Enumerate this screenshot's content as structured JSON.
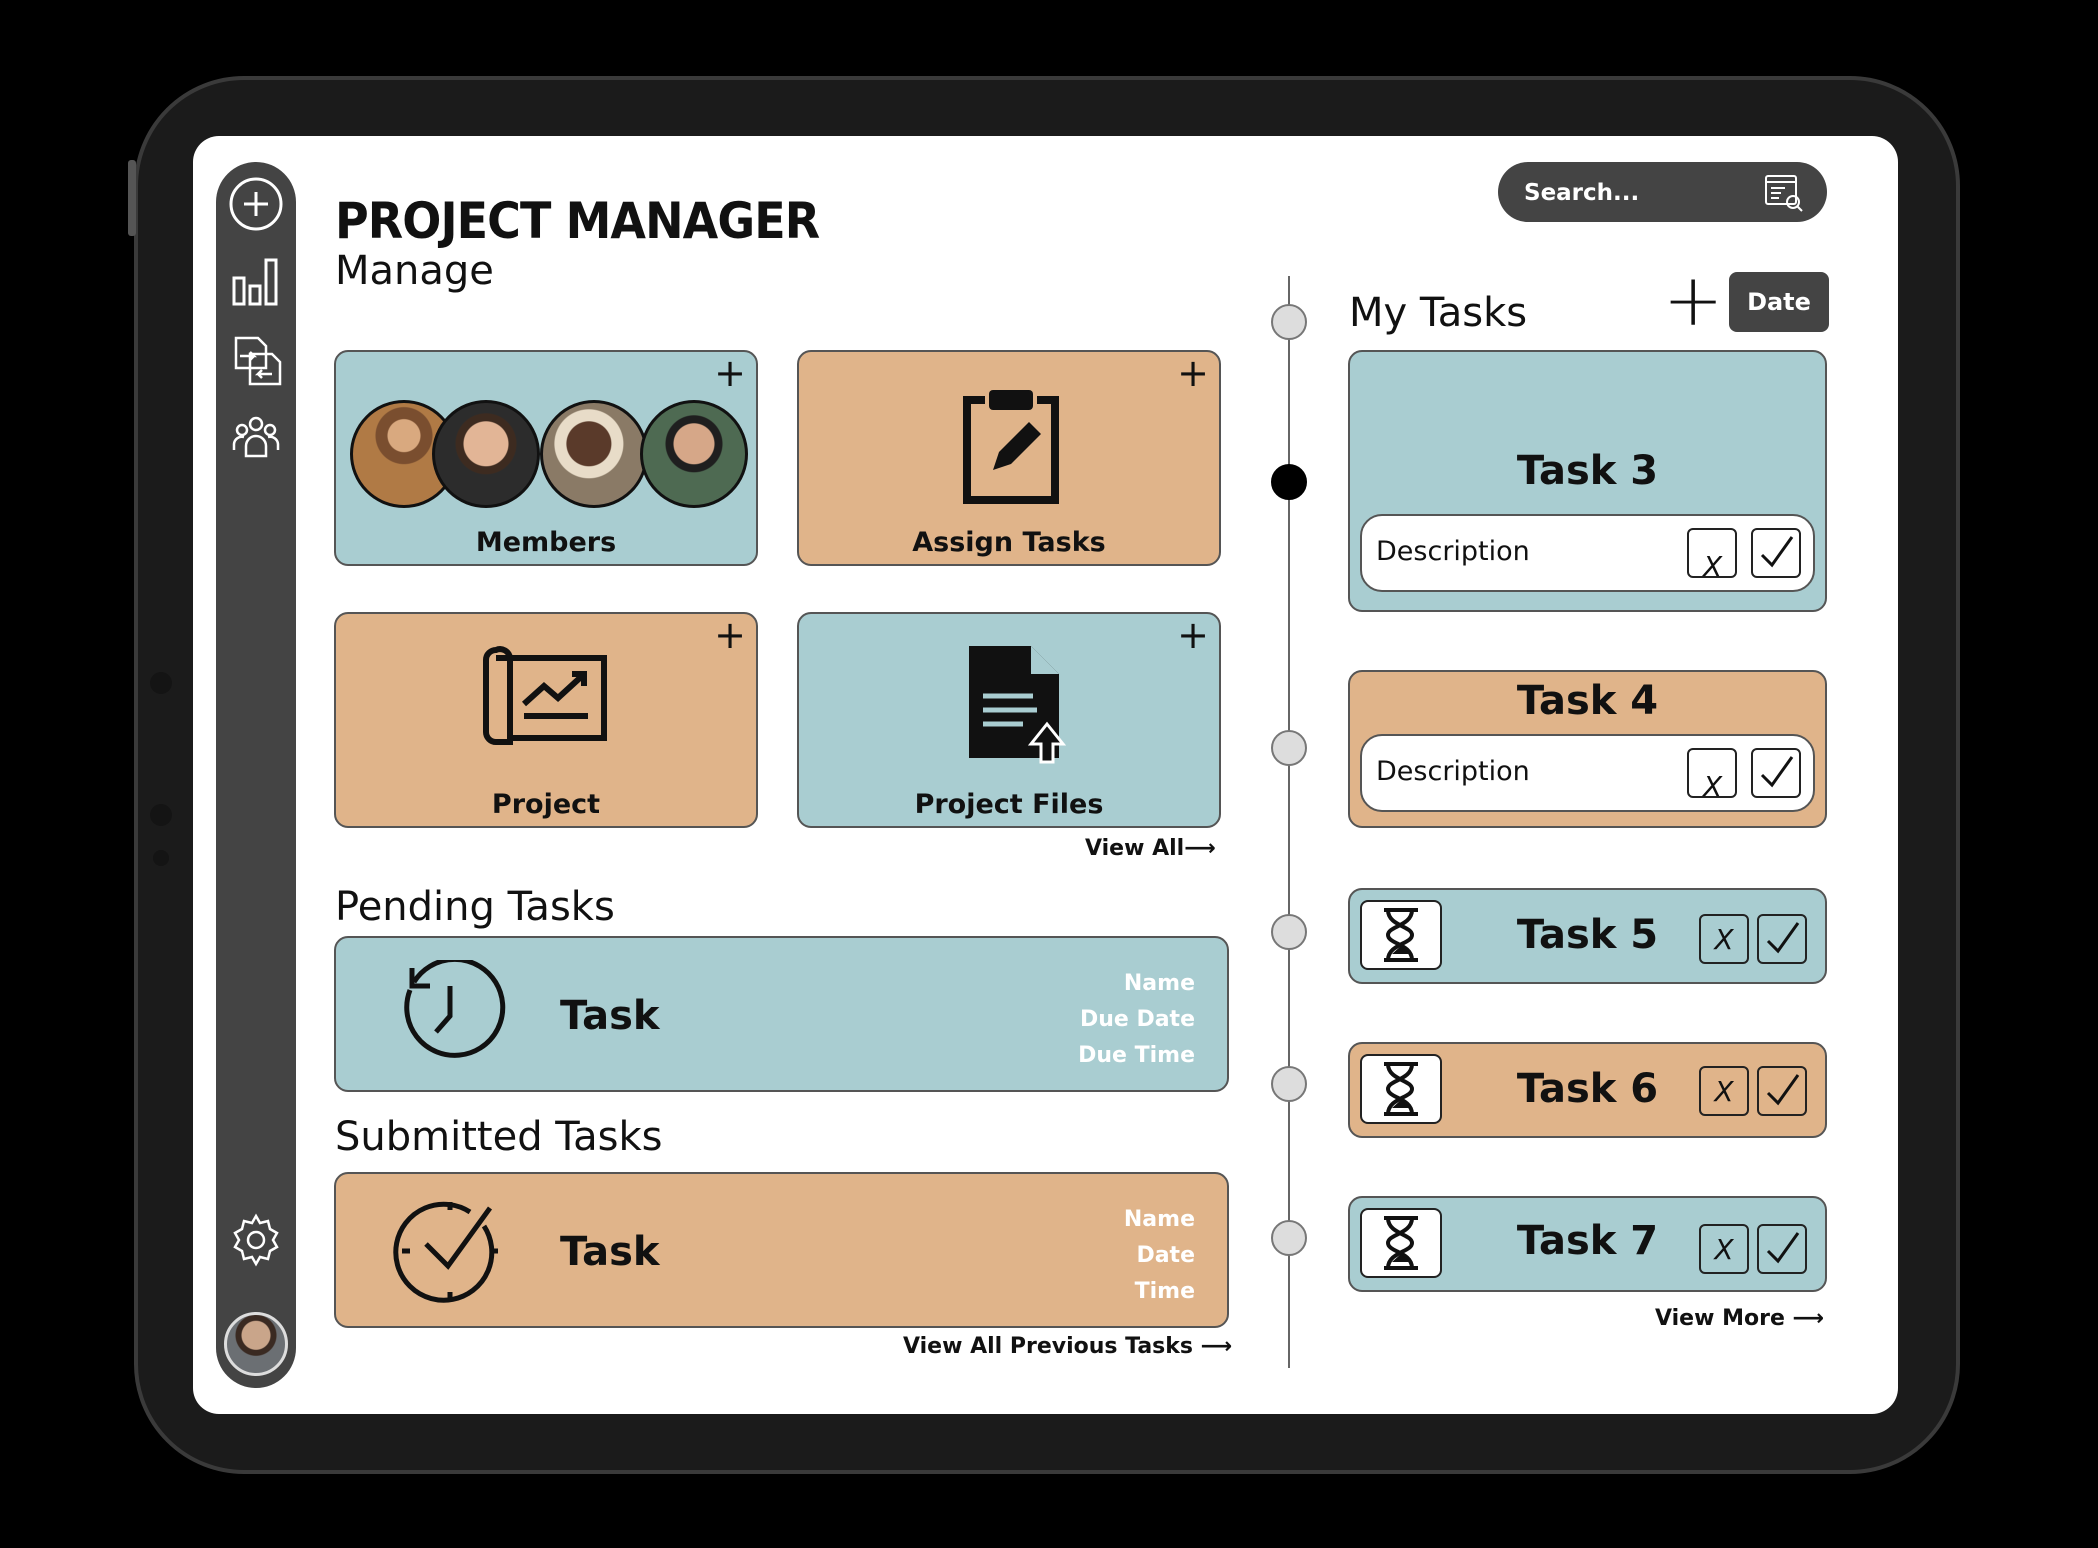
{
  "app": {
    "title": "PROJECT MANAGER"
  },
  "search": {
    "placeholder": "Search..."
  },
  "sidebar": {
    "items": [
      {
        "icon": "add-circle-icon"
      },
      {
        "icon": "bar-chart-icon"
      },
      {
        "icon": "file-transfer-icon"
      },
      {
        "icon": "team-icon"
      },
      {
        "icon": "gear-icon"
      },
      {
        "icon": "avatar"
      }
    ]
  },
  "manage": {
    "heading": "Manage",
    "cards": [
      {
        "label": "Members",
        "color": "#a9cdd1"
      },
      {
        "label": "Assign Tasks",
        "color": "#e0b48a"
      },
      {
        "label": "Project",
        "color": "#e0b48a"
      },
      {
        "label": "Project Files",
        "color": "#a9cdd1"
      }
    ],
    "view_all": "View All⟶"
  },
  "pending": {
    "heading": "Pending Tasks",
    "task": "Task",
    "meta": [
      "Name",
      "Due Date",
      "Due Time"
    ]
  },
  "submitted": {
    "heading": "Submitted Tasks",
    "task": "Task",
    "meta": [
      "Name",
      "Date",
      "Time"
    ],
    "view_all": "View All Previous Tasks ⟶"
  },
  "my_tasks": {
    "heading": "My Tasks",
    "date_button": "Date",
    "tasks": [
      {
        "title": "Task 3",
        "description": "Description",
        "x_label": "X"
      },
      {
        "title": "Task 4",
        "description": "Description",
        "x_label": "X"
      },
      {
        "title": "Task 5",
        "x_label": "X"
      },
      {
        "title": "Task 6",
        "x_label": "X"
      },
      {
        "title": "Task 7",
        "x_label": "X"
      }
    ],
    "view_more": "View More ⟶"
  }
}
